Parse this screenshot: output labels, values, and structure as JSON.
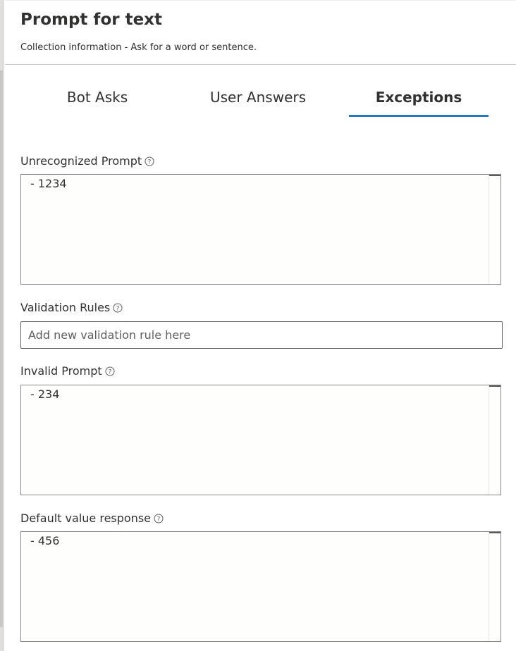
{
  "header": {
    "title": "Prompt for text",
    "subtitle": "Collection information - Ask for a word or sentence."
  },
  "tabs": [
    {
      "label": "Bot Asks",
      "active": false
    },
    {
      "label": "User Answers",
      "active": false
    },
    {
      "label": "Exceptions",
      "active": true
    }
  ],
  "fields": {
    "unrecognized_prompt": {
      "label": "Unrecognized Prompt",
      "value": "- 1234"
    },
    "validation_rules": {
      "label": "Validation Rules",
      "placeholder": "Add new validation rule here",
      "value": ""
    },
    "invalid_prompt": {
      "label": "Invalid Prompt",
      "value": "- 234"
    },
    "default_value_response": {
      "label": "Default value response",
      "value": "- 456"
    }
  },
  "icons": {
    "info": "info-icon"
  },
  "colors": {
    "accent": "#2b78c2",
    "text": "#323130",
    "border": "#8a8886",
    "editor_bg": "#fefefc"
  }
}
